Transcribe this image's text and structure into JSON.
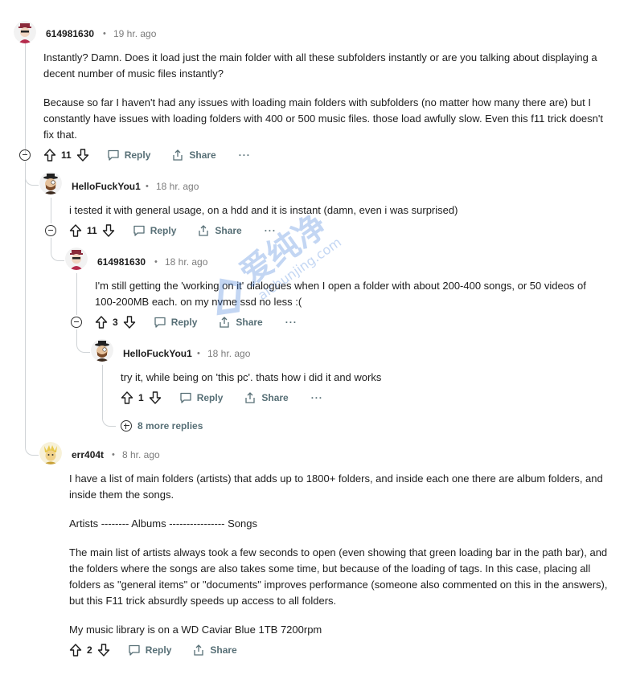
{
  "comments": [
    {
      "author": "614981630",
      "time": "19 hr. ago",
      "paragraphs": [
        "Instantly? Damn. Does it load just the main folder with all these subfolders instantly or are you talking about displaying a decent number of music files instantly?",
        "Because so far I haven't had any issues with loading main folders with subfolders (no matter how many there are) but I constantly have issues with loading folders with 400 or 500 music files. those load awfully slow. Even this f11 trick doesn't fix that."
      ],
      "score": "11"
    },
    {
      "author": "HelloFuckYou1",
      "time": "18 hr. ago",
      "paragraphs": [
        "i tested it with general usage, on a hdd and it is instant (damn, even i was surprised)"
      ],
      "score": "11"
    },
    {
      "author": "614981630",
      "time": "18 hr. ago",
      "paragraphs": [
        "I'm still getting the 'working on it' dialogues when I open a folder with about 200-400 songs, or 50 videos of 100-200MB each. on my nvme ssd no less :("
      ],
      "score": "3"
    },
    {
      "author": "HelloFuckYou1",
      "time": "18 hr. ago",
      "paragraphs": [
        "try it, while being on 'this pc'. thats how i did it and works"
      ],
      "score": "1"
    },
    {
      "author": "err404t",
      "time": "8 hr. ago",
      "paragraphs": [
        "I have a list of main folders (artists) that adds up to 1800+ folders, and inside each one there are album folders, and inside them the songs.",
        "Artists -------- Albums ---------------- Songs",
        "The main list of artists always took a few seconds to open (even showing that green loading bar in the path bar), and the folders where the songs are also takes some time, but because of the loading of tags. In this case, placing all folders as \"general items\" or \"documents\" improves performance (someone also commented on this in the answers), but this F11 trick absurdly speeds up access to all folders.",
        "My music library is on a WD Caviar Blue 1TB 7200rpm"
      ],
      "score": "2"
    }
  ],
  "labels": {
    "reply": "Reply",
    "share": "Share",
    "more": "···",
    "dot": "•",
    "more_replies": "8 more replies"
  },
  "watermark": {
    "text_cn": "爱纯净",
    "text_url": "aichunjing.com"
  },
  "colors": {
    "muted": "#576f76",
    "thread_line": "#cfd3d6",
    "text": "#1c1c1c"
  }
}
